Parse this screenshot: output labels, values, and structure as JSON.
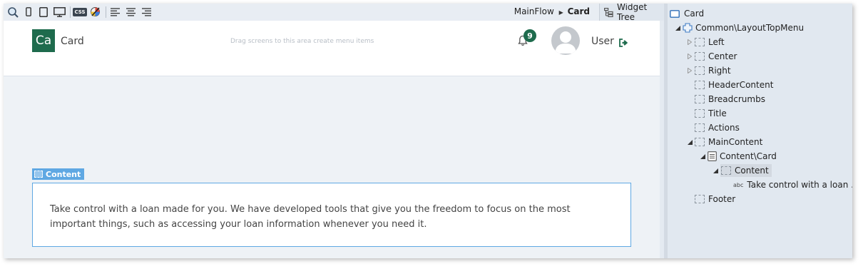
{
  "toolbar": {
    "icons": [
      "inspect-icon",
      "phone-icon",
      "tablet-icon",
      "desktop-icon",
      "css-icon",
      "theme-icon",
      "align-left-icon",
      "align-center-icon",
      "align-right-icon"
    ],
    "css_label": "CSS",
    "breadcrumb": {
      "flow": "MainFlow",
      "screen": "Card"
    },
    "widget_tree_tab": "Widget Tree"
  },
  "header": {
    "logo_text": "Ca",
    "app_name": "Card",
    "drag_hint": "Drag screens to this area create menu items",
    "notification_count": "9",
    "user_name": "User"
  },
  "content": {
    "tag_label": "Content",
    "text": "Take control with a loan made for you. We have developed tools that give you the freedom to focus on the most important things, such as accessing your loan information whenever you need it."
  },
  "tree": {
    "root": "Card",
    "items": [
      {
        "label": "Common\\LayoutTopMenu"
      },
      {
        "label": "Left"
      },
      {
        "label": "Center"
      },
      {
        "label": "Right"
      },
      {
        "label": "HeaderContent"
      },
      {
        "label": "Breadcrumbs"
      },
      {
        "label": "Title"
      },
      {
        "label": "Actions"
      },
      {
        "label": "MainContent"
      },
      {
        "label": "Content\\Card"
      },
      {
        "label": "Content"
      },
      {
        "label": "Take control with a loan ...",
        "prefix": "abc"
      },
      {
        "label": "Footer"
      }
    ]
  },
  "colors": {
    "brand": "#1e6b4d",
    "selection": "#5fa8e3"
  }
}
